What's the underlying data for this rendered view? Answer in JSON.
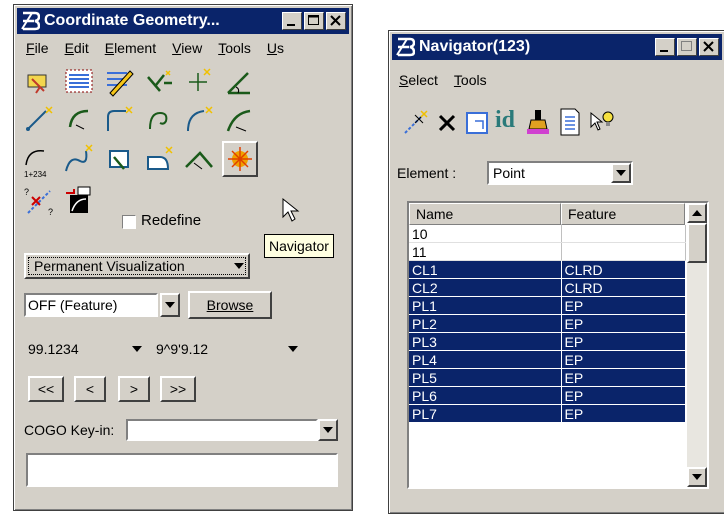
{
  "cogo": {
    "title": "Coordinate Geometry...",
    "menu": [
      "File",
      "Edit",
      "Element",
      "View",
      "Tools",
      "Us"
    ],
    "redefine_label": "Redefine",
    "tooltip": "Navigator",
    "visualization": "Permanent Visualization",
    "mode_value": "OFF (Feature)",
    "browse_label": "Browse",
    "precision_value": "99.1234",
    "angle_value": "9^9'9.12",
    "nav_buttons": [
      "<<",
      "<",
      ">",
      ">>"
    ],
    "keyin_label": "COGO Key-in:",
    "keyin_value": "",
    "curve_station_label": "1+234"
  },
  "navigator": {
    "title": "Navigator(123)",
    "menu": [
      "Select",
      "Tools"
    ],
    "toolbar_id_label": "id",
    "element_label": "Element :",
    "element_value": "Point",
    "columns": [
      "Name",
      "Feature"
    ],
    "rows": [
      {
        "name": "10",
        "feature": "",
        "selected": false
      },
      {
        "name": "11",
        "feature": "",
        "selected": false
      },
      {
        "name": "CL1",
        "feature": "CLRD",
        "selected": true
      },
      {
        "name": "CL2",
        "feature": "CLRD",
        "selected": true
      },
      {
        "name": "PL1",
        "feature": "EP",
        "selected": true
      },
      {
        "name": "PL2",
        "feature": "EP",
        "selected": true
      },
      {
        "name": "PL3",
        "feature": "EP",
        "selected": true
      },
      {
        "name": "PL4",
        "feature": "EP",
        "selected": true
      },
      {
        "name": "PL5",
        "feature": "EP",
        "selected": true
      },
      {
        "name": "PL6",
        "feature": "EP",
        "selected": true
      },
      {
        "name": "PL7",
        "feature": "EP",
        "selected": true
      }
    ]
  }
}
